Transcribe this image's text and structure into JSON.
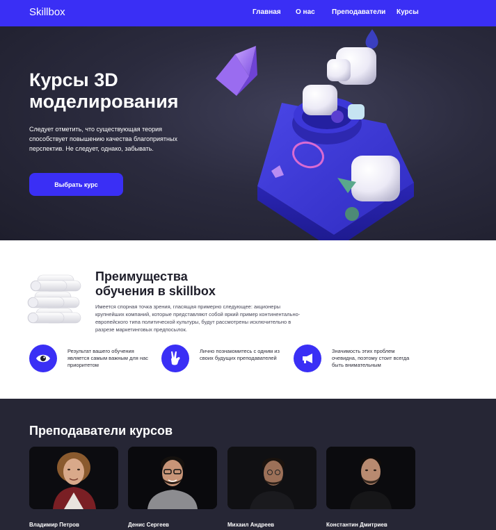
{
  "header": {
    "logo": "Skillbox",
    "nav": [
      "Главная",
      "О нас",
      "Преподаватели",
      "Курсы"
    ]
  },
  "hero": {
    "title_line1": "Курсы 3D",
    "title_line2": "моделирования",
    "text": "Следует отметить, что существующая теория способствует повышению качества благоприятных перспектив. Не следует, однако, забывать.",
    "button": "Выбрать курс"
  },
  "advantages": {
    "title_line1": "Преимущества",
    "title_line2": "обучения в skillbox",
    "text": "Имеется спорная точка зрения, гласящая примерно следующее: акционеры крупнейших компаний, которые представляют собой яркий пример континентально-европейского типа политической культуры, будут рассмотрены исключительно в разрезе маркетинговых предпосылок.",
    "features": [
      {
        "icon": "eye-icon",
        "text": "Результат вашего обучения является самым важным для нас приоритетом"
      },
      {
        "icon": "victory-hand-icon",
        "text": "Лично познакомитесь с одним из своих будущих преподавателей"
      },
      {
        "icon": "megaphone-icon",
        "text": "Значимость этих проблем очевидна, поэтому стоит всегда быть внимательным"
      }
    ]
  },
  "teachers": {
    "title": "Преподаватели курсов",
    "items": [
      {
        "name": "Владимир Петров"
      },
      {
        "name": "Денис Сергеев"
      },
      {
        "name": "Михаил Андреев"
      },
      {
        "name": "Константин Дмитриев"
      }
    ]
  },
  "colors": {
    "accent": "#3a2ff5",
    "hero_bg": "#2b2b3e",
    "teachers_bg": "#262635"
  }
}
